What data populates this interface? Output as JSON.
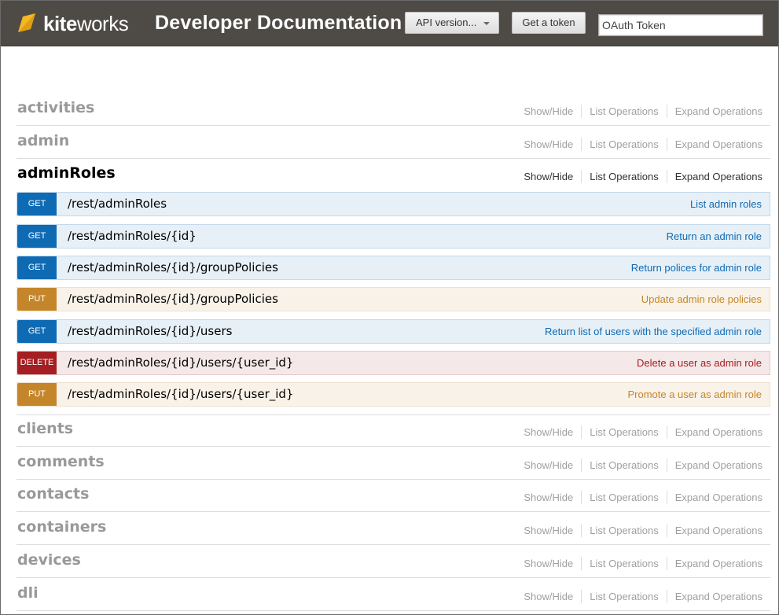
{
  "header": {
    "logo_text_bold": "kite",
    "logo_text_rest": "works",
    "title": "Developer Documentation",
    "api_version_label": "API version...",
    "get_token_label": "Get a token",
    "token_placeholder": "OAuth Token"
  },
  "ops_labels": {
    "show_hide": "Show/Hide",
    "list": "List Operations",
    "expand": "Expand Operations"
  },
  "resources": [
    {
      "name": "activities"
    },
    {
      "name": "admin"
    },
    {
      "name": "adminRoles"
    },
    {
      "name": "clients"
    },
    {
      "name": "comments"
    },
    {
      "name": "contacts"
    },
    {
      "name": "containers"
    },
    {
      "name": "devices"
    },
    {
      "name": "dli"
    }
  ],
  "endpoints": [
    {
      "method": "GET",
      "path": "/rest/adminRoles",
      "summary": "List admin roles"
    },
    {
      "method": "GET",
      "path": "/rest/adminRoles/{id}",
      "summary": "Return an admin role"
    },
    {
      "method": "GET",
      "path": "/rest/adminRoles/{id}/groupPolicies",
      "summary": "Return polices for admin role"
    },
    {
      "method": "PUT",
      "path": "/rest/adminRoles/{id}/groupPolicies",
      "summary": "Update admin role policies"
    },
    {
      "method": "GET",
      "path": "/rest/adminRoles/{id}/users",
      "summary": "Return list of users with the specified admin role"
    },
    {
      "method": "DELETE",
      "path": "/rest/adminRoles/{id}/users/{user_id}",
      "summary": "Delete a user as admin role"
    },
    {
      "method": "PUT",
      "path": "/rest/adminRoles/{id}/users/{user_id}",
      "summary": "Promote a user as admin role"
    }
  ],
  "colors": {
    "header_bg": "#4e4b46",
    "logo_yellow": "#f5b822",
    "get": "#0f6ab4",
    "put": "#c5862b",
    "delete": "#a41e22"
  }
}
